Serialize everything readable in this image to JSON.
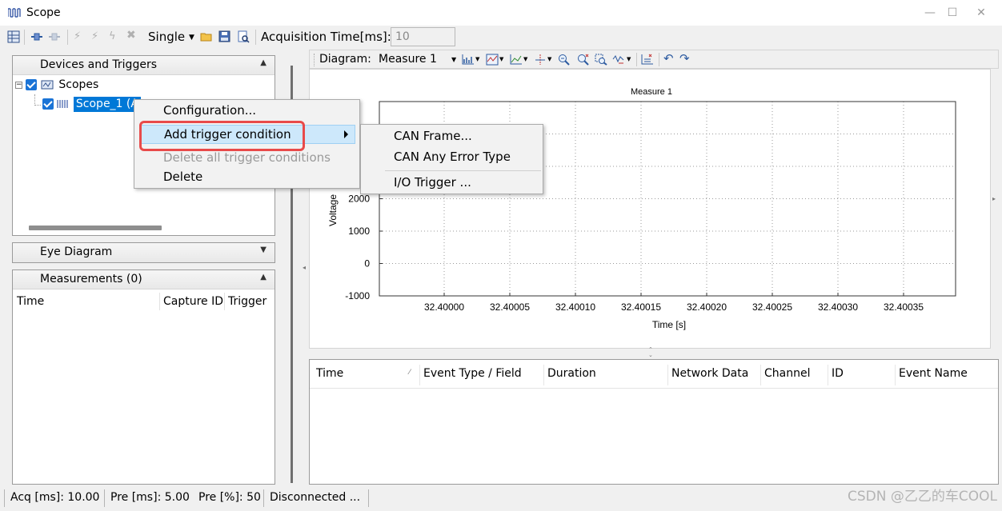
{
  "window": {
    "title": "Scope",
    "minimize": "—",
    "maximize": "☐",
    "close": "✕"
  },
  "toolbar": {
    "mode": "Single",
    "acq_label": "Acquisition Time[ms]:",
    "acq_value": "10"
  },
  "devices_panel": {
    "title": "Devices and Triggers",
    "root_label": "Scopes",
    "scope_label": "Scope_1 (A"
  },
  "eye_panel": {
    "title": "Eye Diagram"
  },
  "measurements_panel": {
    "title": "Measurements (0)",
    "columns": [
      "Time",
      "Capture ID",
      "Trigger"
    ]
  },
  "diagram_toolbar": {
    "label": "Diagram:",
    "selected": "Measure 1"
  },
  "chart_data": {
    "type": "line",
    "title": "Measure 1",
    "xlabel": "Time [s]",
    "ylabel": "Voltage",
    "x_ticks": [
      "32.40000",
      "32.40005",
      "32.40010",
      "32.40015",
      "32.40020",
      "32.40025",
      "32.40030",
      "32.40035"
    ],
    "y_ticks": [
      "-1000",
      "0",
      "1000",
      "2000"
    ],
    "ylim": [
      -1000,
      5000
    ],
    "series": [],
    "grid": true
  },
  "event_table": {
    "columns": [
      "Time",
      "Event Type / Field",
      "Duration",
      "Network Data",
      "Channel",
      "ID",
      "Event Name"
    ]
  },
  "context_menu": {
    "items": [
      "Configuration...",
      "Add trigger condition",
      "Delete all trigger conditions",
      "Delete"
    ]
  },
  "sub_menu": {
    "items": [
      "CAN Frame...",
      "CAN Any Error Type",
      "I/O Trigger ..."
    ]
  },
  "statusbar": {
    "acq": "Acq [ms]: 10.00",
    "pre_ms": "Pre [ms]:  5.00",
    "pre_pct": "Pre [%]:  50",
    "state": "Disconnected ..."
  },
  "watermark": "CSDN @乙乙的车COOL",
  "colors": {
    "accent": "#1a73d6",
    "selection": "#0078d7",
    "highlight": "#cde8fb",
    "red_box": "#e84a4a"
  }
}
